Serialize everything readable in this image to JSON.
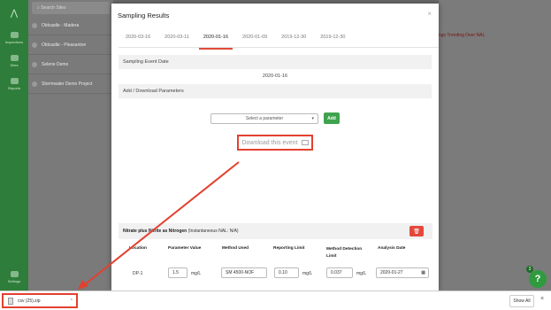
{
  "sidebar": {
    "search_placeholder": "Search Sites",
    "sites": [
      "Oldcastle - Madera",
      "Oldcastle - Pleasanton",
      "Selene Demo",
      "Stormwater Demo Project"
    ],
    "nav": [
      "Inspections",
      "Sites",
      "Reports",
      "Settings"
    ]
  },
  "background": {
    "alert_text": "ngs Trending Over NAL"
  },
  "modal": {
    "title": "Sampling Results",
    "close": "×",
    "tabs": [
      "2020-03-16",
      "2020-03-11",
      "2020-01-16",
      "2020-01-09",
      "2019-12-30",
      "2019-12-30"
    ],
    "active_tab_index": 2,
    "event_date_label": "Sampling Event Date",
    "event_date_value": "2020-01-16",
    "add_download_label": "Add / Download Parameters",
    "select_placeholder": "Select a parameter",
    "add_label": "Add",
    "download_label": "Download this event",
    "param": {
      "name": "Nitrate plus Nitrite as Nitrogen",
      "nal": "(Instantaneous NAL: N/A)",
      "columns": [
        "Location",
        "Parameter Value",
        "Method Used",
        "Reporting Limit",
        "Method Detection Limit",
        "Analysis Date"
      ],
      "row": {
        "location": "DP-1",
        "value": "1.5",
        "value_unit": "mg/L",
        "method": "SM 4500-NOF",
        "reporting_limit": "0.10",
        "rl_unit": "mg/L",
        "mdl": "0.037",
        "mdl_unit": "mg/L",
        "analysis_date": "2020-01-27"
      }
    }
  },
  "downloads": {
    "file_name": "csv (25).zip",
    "show_all": "Show All",
    "close": "×"
  },
  "help": {
    "badge": "3",
    "label": "?"
  },
  "colors": {
    "accent_red": "#e3412f",
    "brand_green": "#2f7d3a",
    "add_green": "#3fa34d"
  }
}
